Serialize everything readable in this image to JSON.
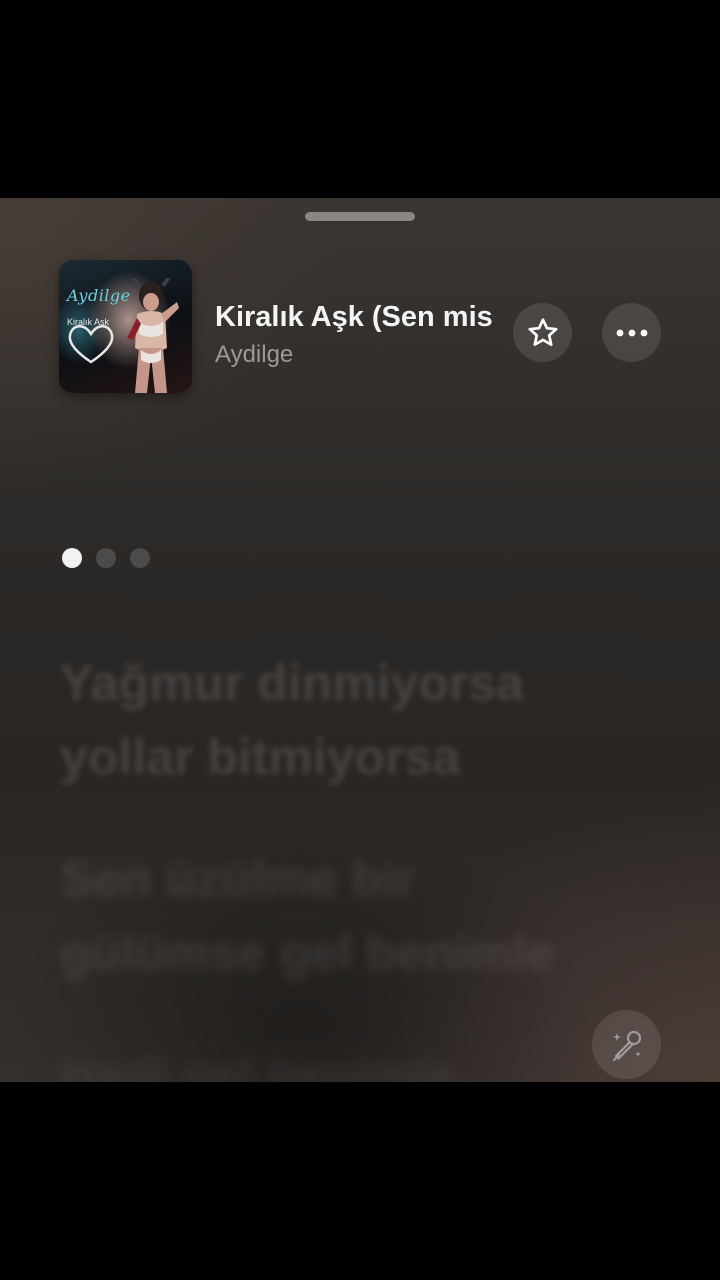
{
  "now_playing": {
    "title": "Kiralık Aşk (Sen mis",
    "artist": "Aydilge",
    "artwork": {
      "artist_script": "Aydilge",
      "album_text": "Kiralık Aşk"
    }
  },
  "controls": {
    "favorite_icon": "star-outline-icon",
    "more_icon": "ellipsis-icon",
    "sing_icon": "microphone-sparkle-icon"
  },
  "pager": {
    "pages": 3,
    "active_index": 0
  },
  "lyrics": [
    {
      "lines": [
        "Yağmur dinmiyorsa",
        "yollar bitmiyorsa"
      ]
    },
    {
      "lines": [
        "Sen üzülme bir",
        "gülümse gel benimle"
      ]
    },
    {
      "lines": [
        "Hadi gel benimle"
      ]
    }
  ],
  "colors": {
    "background": "#2c2a28",
    "title_text": "#f4f4f4",
    "artist_text": "#9c9996"
  }
}
